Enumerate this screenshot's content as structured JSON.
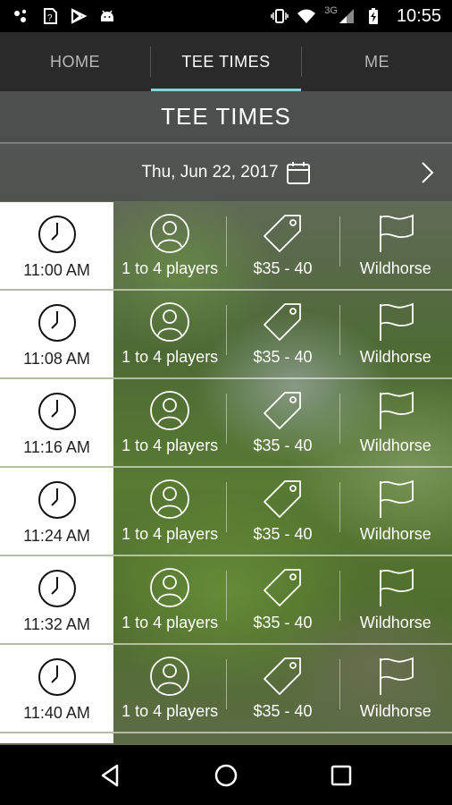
{
  "status_bar": {
    "time": "10:55",
    "network_label": "3G",
    "icons": [
      "notification-dots-icon",
      "sim-icon",
      "play-store-icon",
      "android-icon",
      "vibrate-icon",
      "wifi-icon",
      "signal-icon",
      "battery-charging-icon"
    ]
  },
  "tabs": [
    {
      "label": "HOME",
      "active": false
    },
    {
      "label": "TEE TIMES",
      "active": true
    },
    {
      "label": "ME",
      "active": false
    }
  ],
  "header": {
    "title": "TEE TIMES"
  },
  "date_bar": {
    "date": "Thu, Jun 22, 2017",
    "icons": [
      "calendar-icon",
      "chevron-right-icon"
    ]
  },
  "tee_times": [
    {
      "time": "11:00 AM",
      "players": "1 to 4 players",
      "price": "$35 - 40",
      "course": "Wildhorse"
    },
    {
      "time": "11:08 AM",
      "players": "1 to 4 players",
      "price": "$35 - 40",
      "course": "Wildhorse"
    },
    {
      "time": "11:16 AM",
      "players": "1 to 4 players",
      "price": "$35 - 40",
      "course": "Wildhorse"
    },
    {
      "time": "11:24 AM",
      "players": "1 to 4 players",
      "price": "$35 - 40",
      "course": "Wildhorse"
    },
    {
      "time": "11:32 AM",
      "players": "1 to 4 players",
      "price": "$35 - 40",
      "course": "Wildhorse"
    },
    {
      "time": "11:40 AM",
      "players": "1 to 4 players",
      "price": "$35 - 40",
      "course": "Wildhorse"
    }
  ],
  "row_icons": [
    "clock-icon",
    "user-icon",
    "price-tag-icon",
    "flag-icon"
  ],
  "nav_bar": {
    "icons": [
      "back-icon",
      "home-icon",
      "recents-icon"
    ]
  },
  "colors": {
    "tab_indicator": "#7fd6d6",
    "tab_bar_bg": "#2a2a2a",
    "time_cell_bg": "#ffffff"
  }
}
